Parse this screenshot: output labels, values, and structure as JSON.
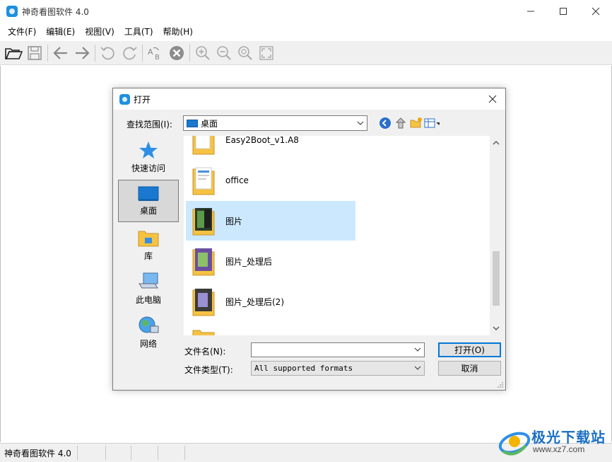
{
  "app": {
    "title": "神奇看图软件 4.0",
    "accent_color": "#1d8fe0"
  },
  "menu": [
    "文件(F)",
    "编辑(E)",
    "视图(V)",
    "工具(T)",
    "帮助(H)"
  ],
  "toolbar": {
    "icons": [
      "open-folder-icon",
      "save-icon",
      "back-arrow-icon",
      "forward-arrow-icon",
      "rotate-left-icon",
      "rotate-right-icon",
      "rename-icon",
      "delete-icon",
      "zoom-in-icon",
      "zoom-out-icon",
      "zoom-fit-icon",
      "fullscreen-icon"
    ]
  },
  "status": {
    "text": "神奇看图软件 4.0"
  },
  "dialog": {
    "title": "打开",
    "lookin_label": "查找范围(I):",
    "lookin_value": "桌面",
    "places": [
      "快速访问",
      "桌面",
      "库",
      "此电脑",
      "网络"
    ],
    "selected_place": "桌面",
    "files": [
      "Easy2Boot_v1.A8",
      "office",
      "图片",
      "图片_处理后",
      "图片_处理后(2)"
    ],
    "selected_file": "图片",
    "filename_label": "文件名(N):",
    "filename_value": "",
    "filetype_label": "文件类型(T):",
    "filetype_value": "All supported formats",
    "open_button": "打开(O)",
    "cancel_button": "取消"
  },
  "watermark": {
    "brand": "极光下载站",
    "url": "www.xz7.com"
  }
}
